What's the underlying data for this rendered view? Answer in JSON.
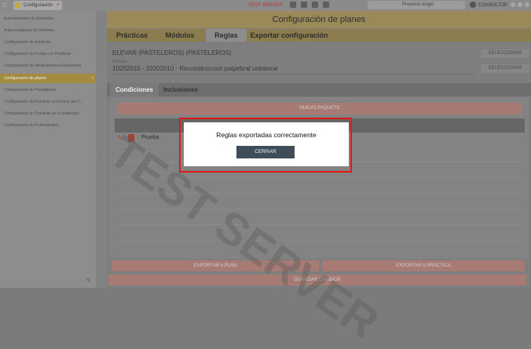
{
  "topbar": {
    "app_tab_label": "Configuración",
    "close_glyph": "×",
    "test_server": "TEST SERVER",
    "project_select": "Proyecto ángel",
    "user_name": "CONSULTOR"
  },
  "sidebar": {
    "items": [
      {
        "label": "Autorizaciones de Entidades"
      },
      {
        "label": "Autocompletado de Informes"
      },
      {
        "label": "Configuración de prácticas"
      },
      {
        "label": "Configuración de Fichas con Prácticas"
      },
      {
        "label": "Configuración de Medicamentos Estándares"
      },
      {
        "label": "Configuración de planes"
      },
      {
        "label": "Configuración de Prestadores"
      },
      {
        "label": "Configuración de Prácticas a Facturar por C..."
      },
      {
        "label": "Configuración de Prácticas de la Institución"
      },
      {
        "label": "Configuración de Profesionales"
      }
    ],
    "active_index": 5
  },
  "main": {
    "title": "Configuración de planes",
    "tabs": [
      "Prácticas",
      "Módulos",
      "Reglas",
      "Exportar configuración"
    ],
    "selected_tab": "Reglas",
    "plan_value": "ELEVAR (PASTELEROS) (PASTELEROS)",
    "select_label": "SELECCIONAR",
    "practice_label": "Práctica",
    "practice_value": "10202010 - 10202010 - Reconstruccion palpebral unilateral",
    "subtabs": [
      "Condiciones",
      "Inclusiones"
    ],
    "nuevo_paquete": "NUEVO PAQUETE",
    "rows": [
      {
        "name": "Prueba"
      }
    ],
    "exportar_plan": "EXPORTAR A PLAN",
    "exportar_practica": "EXPORTAR A PRÁCTICA",
    "guardar_cambios": "GUARDAR CAMBIOS",
    "watermark": "TEST SERVER"
  },
  "dialog": {
    "message": "Reglas exportadas correctamente",
    "close_button": "CERRAR"
  }
}
